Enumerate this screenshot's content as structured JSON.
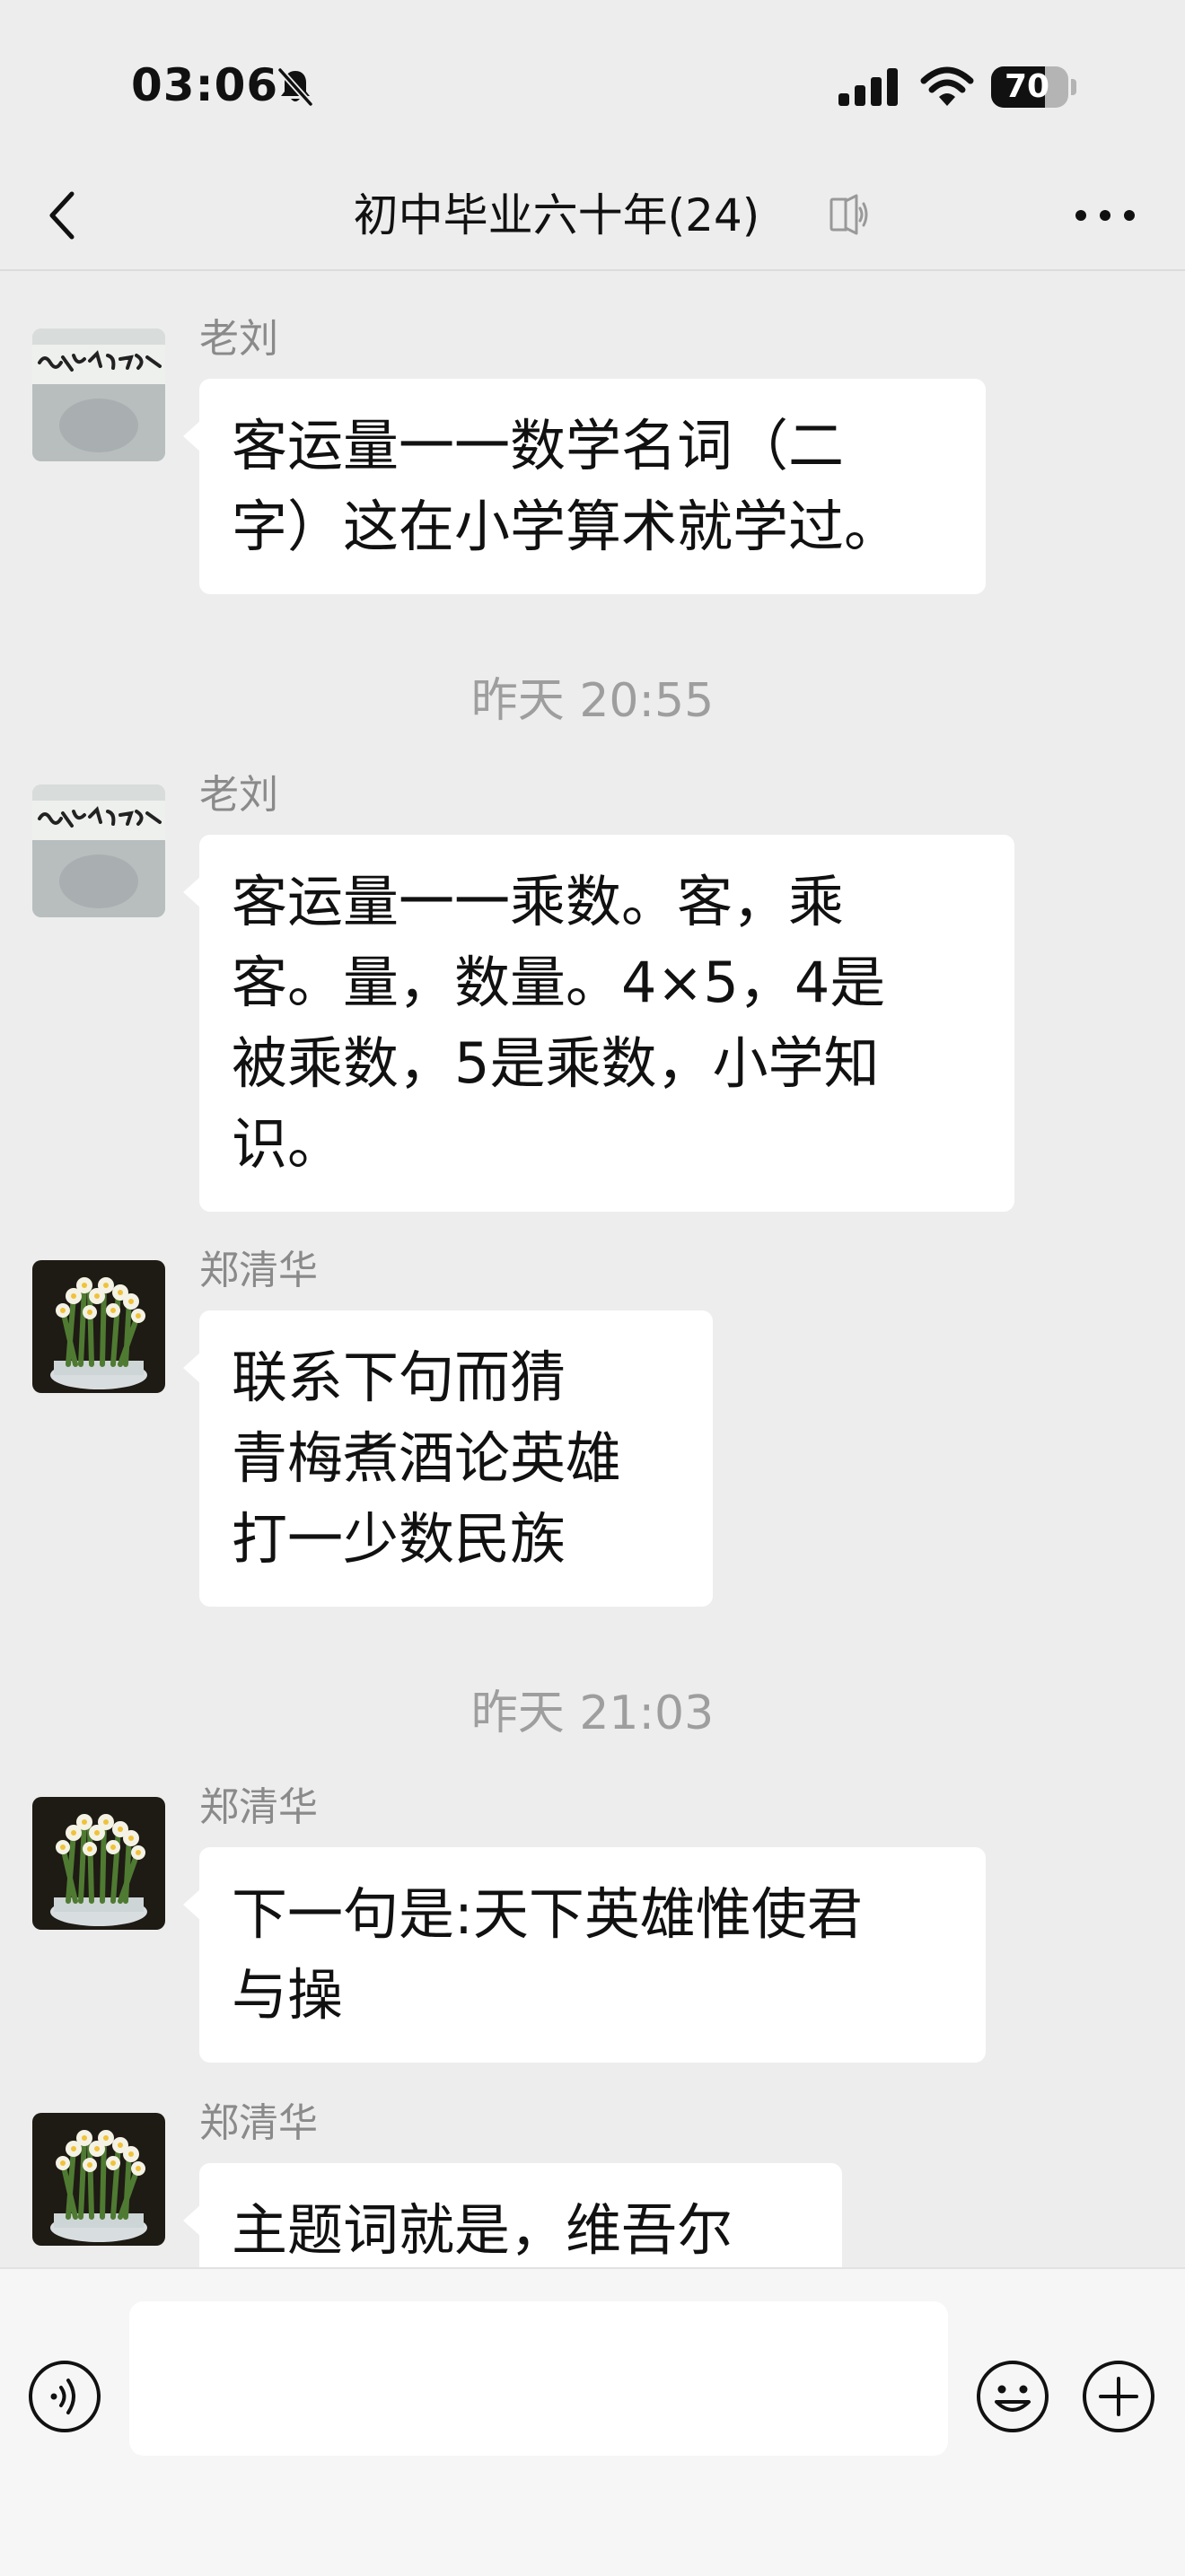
{
  "status_bar": {
    "time": "03:06",
    "battery_level": "70",
    "battery_fraction": 0.7,
    "icons": [
      "bell-off-icon",
      "signal-icon",
      "wifi-icon",
      "battery-icon"
    ]
  },
  "nav": {
    "title": "初中毕业六十年(24)",
    "icons": [
      "back-chevron-icon",
      "mute-icon",
      "more-icon"
    ]
  },
  "messages": [
    {
      "type": "message",
      "sender": "老刘",
      "avatar": "calligraphy-avatar",
      "text": "客运量一一数学名词（二\n字）这在小学算术就学过。"
    },
    {
      "type": "timestamp",
      "text": "昨天 20:55"
    },
    {
      "type": "message",
      "sender": "老刘",
      "avatar": "calligraphy-avatar",
      "text": "客运量一一乘数。客，乘\n客。量，数量。4×5，4是\n被乘数，5是乘数，小学知\n识。"
    },
    {
      "type": "message",
      "sender": "郑清华",
      "avatar": "narcissus-flower-avatar",
      "text": "联系下句而猜\n青梅煮酒论英雄\n打一少数民族"
    },
    {
      "type": "timestamp",
      "text": "昨天 21:03"
    },
    {
      "type": "message",
      "sender": "郑清华",
      "avatar": "narcissus-flower-avatar",
      "text": "下一句是:天下英雄惟使君\n与操"
    },
    {
      "type": "message",
      "sender": "郑清华",
      "avatar": "narcissus-flower-avatar",
      "text": "主题词就是，维吾尔"
    }
  ],
  "input_bar": {
    "value": "",
    "icons": [
      "voice-toggle-icon",
      "mic-icon",
      "emoji-icon",
      "add-icon"
    ]
  },
  "colors": {
    "background": "#ededed",
    "bubble": "#ffffff",
    "text": "#111111",
    "secondary_text": "#8a8a8a",
    "timestamp": "#9e9e9e"
  }
}
